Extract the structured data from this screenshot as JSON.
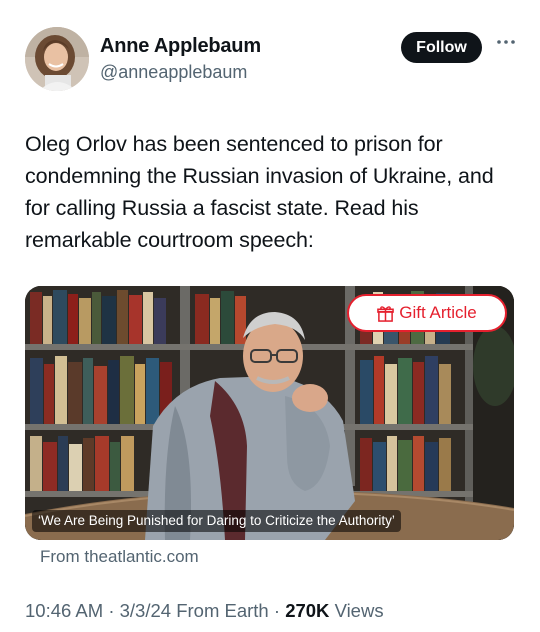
{
  "author": {
    "name": "Anne Applebaum",
    "handle": "@anneapplebaum",
    "avatar_icon": "profile-photo"
  },
  "follow_label": "Follow",
  "more_icon": "more-horizontal-icon",
  "tweet_text": "Oleg Orlov has been sentenced to prison for condemning the Russian invasion of Ukraine, and for calling Russia a fascist state. Read his remarkable courtroom speech:",
  "card": {
    "gift_label": "Gift Article",
    "gift_icon": "gift-icon",
    "caption": "‘We Are Being Punished for Daring to Criticize the Authority’",
    "source": "From theatlantic.com"
  },
  "meta": {
    "time": "10:46 AM",
    "date": "3/3/24",
    "location": "From Earth",
    "views_count": "270K",
    "views_label": "Views",
    "separator": "·"
  },
  "colors": {
    "text": "#0f1419",
    "secondary": "#536471",
    "follow_bg": "#0f1419",
    "gift_red": "#e5202e"
  }
}
